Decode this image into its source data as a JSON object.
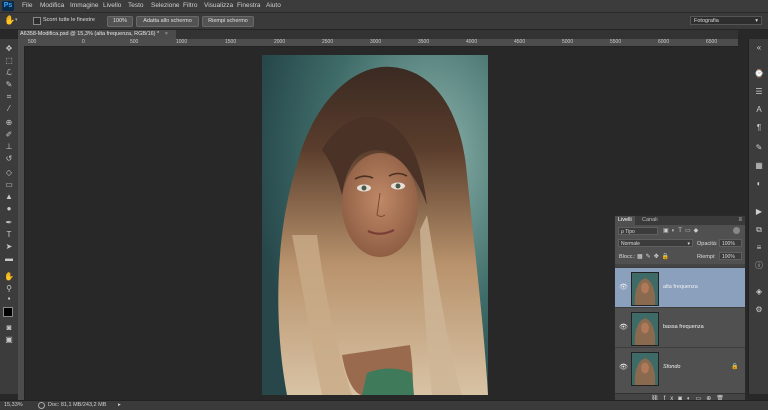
{
  "app": {
    "logo": "Ps"
  },
  "menu": [
    "File",
    "Modifica",
    "Immagine",
    "Livello",
    "Testo",
    "Selezione",
    "Filtro",
    "Visualizza",
    "Finestra",
    "Aiuto"
  ],
  "options_bar": {
    "scroll_all_label": "Scorri tutte le finestre",
    "zoom_100": "100%",
    "fit_screen": "Adatta allo schermo",
    "fill_screen": "Riempi schermo",
    "workspace": "Fotografia"
  },
  "document": {
    "tab_title": "A6358-Modifica.psd @ 15,3% (alta frequenza, RGB/16) *"
  },
  "ruler_labels": [
    "500",
    "0",
    "500",
    "1000",
    "1500",
    "2000",
    "2500",
    "3000",
    "3500",
    "4000",
    "4500",
    "5000",
    "5500",
    "6000",
    "6500"
  ],
  "layers_panel": {
    "tabs": [
      "Livelli",
      "Canali"
    ],
    "kind_filter": "ρ Tipo",
    "blend_mode": "Normale",
    "opacity_label": "Opacità:",
    "opacity_value": "100%",
    "lock_label": "Blocc.:",
    "fill_label": "Riempi:",
    "fill_value": "100%",
    "layers": [
      {
        "name": "alta frequenza",
        "selected": true,
        "visible": true
      },
      {
        "name": "bassa frequenza",
        "selected": false,
        "visible": true
      },
      {
        "name": "Sfondo",
        "selected": false,
        "visible": true,
        "locked": true
      }
    ]
  },
  "status": {
    "zoom": "15,33%",
    "doc_info": "Doc: 81,1 MB/243,2 MB"
  },
  "colors": {
    "accent_selected_layer": "#8aa0bd",
    "ps_blue": "#31a8ff"
  }
}
